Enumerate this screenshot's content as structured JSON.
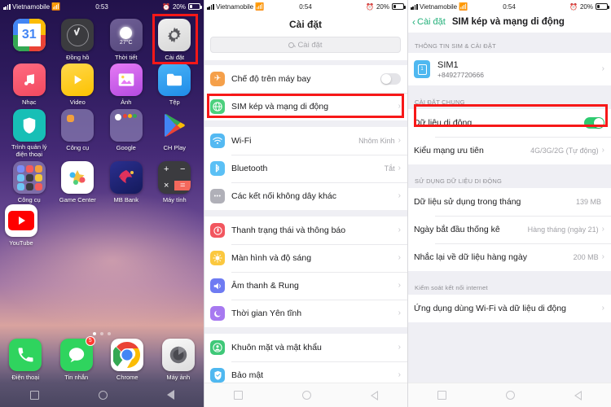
{
  "home": {
    "statusbar": {
      "carrier": "Vietnamobile",
      "time": "0:53",
      "battery": "20%",
      "wifi_icon": "wifi-off-icon",
      "alarm_icon": "alarm-icon",
      "signal_icon": "signal-bars-icon"
    },
    "apps_rows": [
      [
        {
          "label": "",
          "icon": "calendar-icon",
          "day": "31"
        },
        {
          "label": "Đồng hồ",
          "icon": "clock-icon"
        },
        {
          "label": "Thời tiết",
          "icon": "weather-icon",
          "temp": "27°C"
        },
        {
          "label": "Cài đặt",
          "icon": "settings-gear-icon"
        }
      ],
      [
        {
          "label": "Nhạc",
          "icon": "music-icon"
        },
        {
          "label": "Video",
          "icon": "video-icon"
        },
        {
          "label": "Ảnh",
          "icon": "photos-icon"
        },
        {
          "label": "Tệp",
          "icon": "files-icon"
        }
      ],
      [
        {
          "label": "Trình quản lý điện thoại",
          "icon": "phone-manager-shield-icon"
        },
        {
          "label": "Công cụ",
          "icon": "tools-folder-icon"
        },
        {
          "label": "Google",
          "icon": "google-folder-icon"
        },
        {
          "label": "CH Play",
          "icon": "play-store-icon"
        }
      ],
      [
        {
          "label": "Công cụ",
          "icon": "utilities-folder-icon"
        },
        {
          "label": "Game Center",
          "icon": "game-center-icon"
        },
        {
          "label": "MB Bank",
          "icon": "mb-bank-icon"
        },
        {
          "label": "Máy tính",
          "icon": "calculator-icon"
        }
      ],
      [
        {
          "label": "YouTube",
          "icon": "youtube-icon"
        }
      ]
    ],
    "dock": [
      {
        "label": "Điện thoại",
        "icon": "phone-icon"
      },
      {
        "label": "Tin nhắn",
        "icon": "messages-icon",
        "badge": "5"
      },
      {
        "label": "Chrome",
        "icon": "chrome-icon"
      },
      {
        "label": "Máy ảnh",
        "icon": "camera-icon"
      }
    ],
    "page_dots": 3,
    "active_dot": 0
  },
  "settings": {
    "statusbar": {
      "carrier": "Vietnamobile",
      "time": "0:54",
      "battery": "20%"
    },
    "title": "Cài đặt",
    "search_placeholder": "Cài đặt",
    "groups": [
      {
        "rows": [
          {
            "label": "Chế độ trên máy bay",
            "icon": "airplane-icon",
            "color": "bg-orange",
            "glyph": "✈",
            "control": "toggle-off"
          },
          {
            "label": "SIM kép và mạng di động",
            "icon": "globe-sim-icon",
            "color": "bg-green",
            "glyph": "🌐",
            "control": "chevron",
            "highlighted": true
          }
        ]
      },
      {
        "rows": [
          {
            "label": "Wi-Fi",
            "icon": "wifi-icon",
            "color": "bg-blue",
            "glyph": "",
            "value": "Nhôm Kinh",
            "control": "chevron"
          },
          {
            "label": "Bluetooth",
            "icon": "bluetooth-icon",
            "color": "bg-ltblue",
            "glyph": "",
            "value": "Tắt",
            "control": "chevron"
          },
          {
            "label": "Các kết nối không dây khác",
            "icon": "more-dots-icon",
            "color": "bg-grey",
            "glyph": "•••",
            "control": "chevron"
          }
        ]
      },
      {
        "rows": [
          {
            "label": "Thanh trạng thái và thông báo",
            "icon": "status-bar-icon",
            "color": "bg-red",
            "glyph": "",
            "control": "chevron"
          },
          {
            "label": "Màn hình và độ sáng",
            "icon": "brightness-icon",
            "color": "bg-yellow",
            "glyph": "",
            "control": "chevron"
          },
          {
            "label": "Âm thanh & Rung",
            "icon": "sound-icon",
            "color": "bg-indigo",
            "glyph": "",
            "control": "chevron"
          },
          {
            "label": "Thời gian Yên tĩnh",
            "icon": "do-not-disturb-moon-icon",
            "color": "bg-purple",
            "glyph": "",
            "control": "chevron"
          }
        ]
      },
      {
        "rows": [
          {
            "label": "Khuôn mặt và mật khẩu",
            "icon": "face-unlock-icon",
            "color": "bg-green2",
            "glyph": "",
            "control": "chevron"
          },
          {
            "label": "Bảo mật",
            "icon": "security-shield-icon",
            "color": "bg-cyan",
            "glyph": "",
            "control": "chevron"
          }
        ]
      }
    ]
  },
  "sim_page": {
    "statusbar": {
      "carrier": "Vietnamobile",
      "time": "0:54",
      "battery": "20%"
    },
    "back_label": "Cài đặt",
    "title": "SIM kép và mạng di động",
    "section1_header": "THÔNG TIN SIM & CÀI ĐẶT",
    "sim": {
      "name": "SIM1",
      "number": "+84927720666",
      "icon": "sim-card-icon"
    },
    "section2_header": "CÀI ĐẶT CHUNG",
    "general_rows": [
      {
        "label": "Dữ liệu di động",
        "control": "toggle-on",
        "highlighted": true
      },
      {
        "label": "Kiểu mạng ưu tiên",
        "value": "4G/3G/2G (Tự động)",
        "control": "chevron"
      }
    ],
    "section3_header": "SỬ DỤNG DỮ LIỆU DI ĐỘNG",
    "usage_rows": [
      {
        "label": "Dữ liệu sử dụng trong tháng",
        "value": "139 MB",
        "control": "none"
      },
      {
        "label": "Ngày bắt đầu thống kê",
        "value": "Hàng tháng (ngày 21)",
        "control": "chevron"
      },
      {
        "label": "Nhắc lại về dữ liệu hàng ngày",
        "value": "200 MB",
        "control": "chevron"
      }
    ],
    "section4_header": "Kiểm soát kết nối internet",
    "internet_rows": [
      {
        "label": "Ứng dụng dùng Wi-Fi và dữ liệu di động",
        "control": "chevron"
      }
    ]
  },
  "nav_bar": {
    "recents": "recents-square-icon",
    "home": "home-circle-icon",
    "back": "back-triangle-icon"
  },
  "annotation_color": "#f71818"
}
